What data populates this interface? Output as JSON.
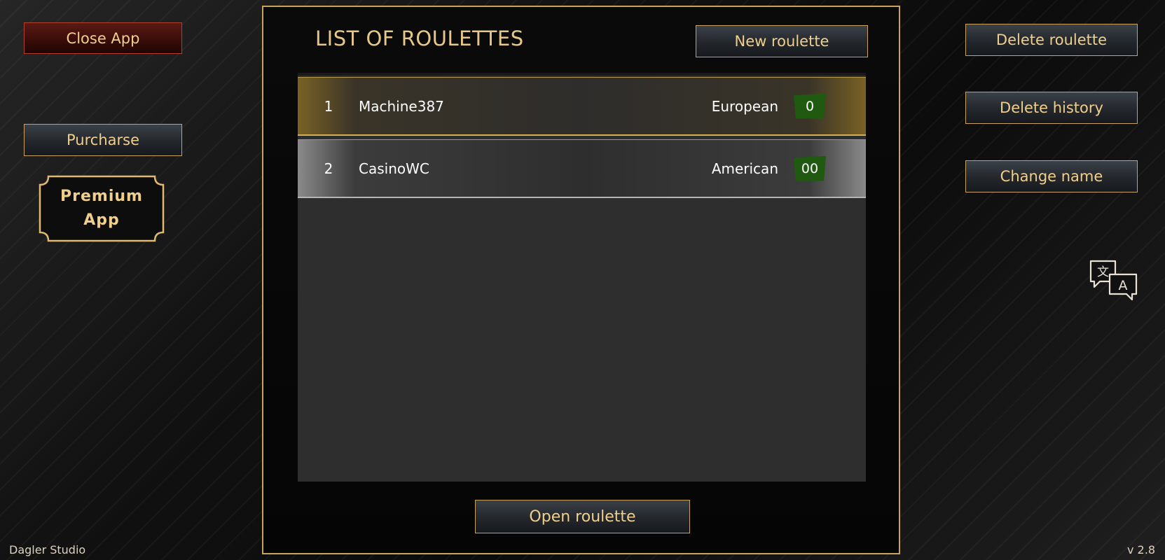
{
  "left": {
    "close_app": "Close App",
    "purchase": "Purcharse",
    "premium_line1": "Premium",
    "premium_line2": "App"
  },
  "panel": {
    "title": "LIST OF ROULETTES",
    "new_roulette": "New roulette",
    "open_roulette": "Open roulette",
    "roulettes": [
      {
        "index": "1",
        "name": "Machine387",
        "type": "European",
        "zero": "0",
        "selected": true
      },
      {
        "index": "2",
        "name": "CasinoWC",
        "type": "American",
        "zero": "00",
        "selected": false
      }
    ]
  },
  "right": {
    "delete_roulette": "Delete roulette",
    "delete_history": "Delete history",
    "change_name": "Change name",
    "translate_icon": "translate-icon"
  },
  "footer": {
    "studio": "Dagler Studio",
    "version": "v 2.8"
  },
  "colors": {
    "gold": "#e8c887",
    "zero_green": "#1f5a10",
    "close_red": "#3a0d09"
  }
}
